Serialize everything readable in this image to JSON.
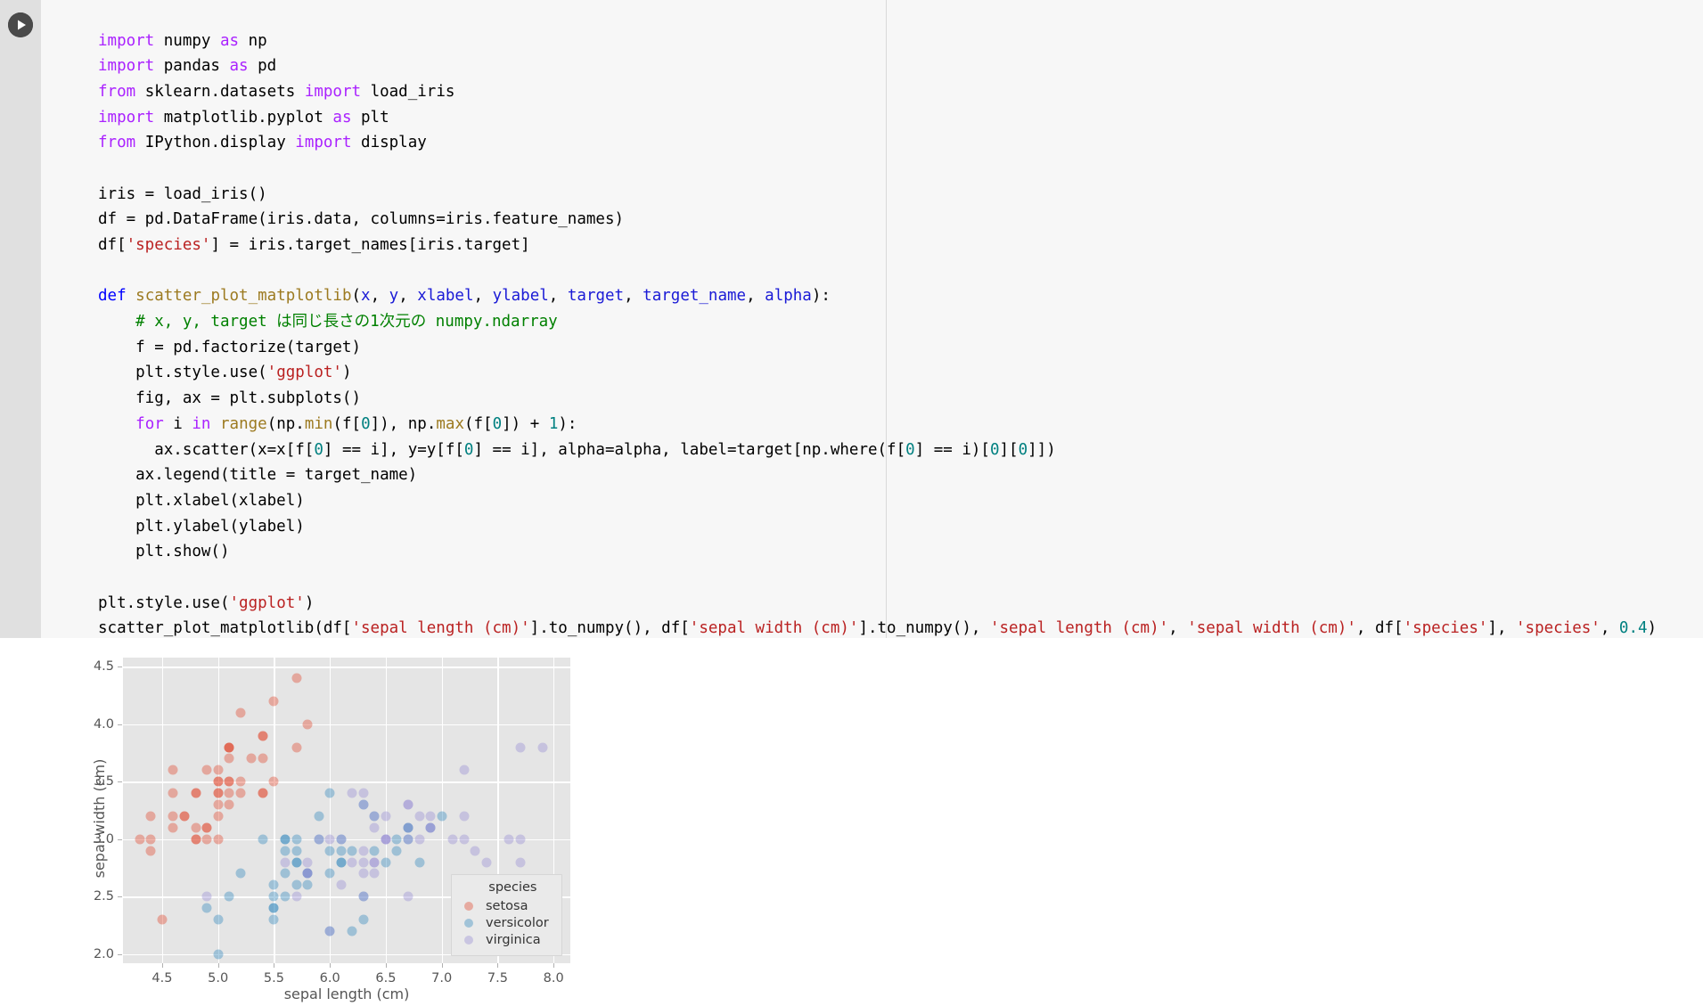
{
  "notebook": {
    "run_button_label": "run-cell",
    "code_lines": [
      [
        {
          "t": "import",
          "c": "kw"
        },
        {
          "t": " numpy ",
          "c": "plain"
        },
        {
          "t": "as",
          "c": "kw"
        },
        {
          "t": " np",
          "c": "plain"
        }
      ],
      [
        {
          "t": "import",
          "c": "kw"
        },
        {
          "t": " pandas ",
          "c": "plain"
        },
        {
          "t": "as",
          "c": "kw"
        },
        {
          "t": " pd",
          "c": "plain"
        }
      ],
      [
        {
          "t": "from",
          "c": "kw"
        },
        {
          "t": " sklearn.datasets ",
          "c": "plain"
        },
        {
          "t": "import",
          "c": "kw"
        },
        {
          "t": " load_iris",
          "c": "plain"
        }
      ],
      [
        {
          "t": "import",
          "c": "kw"
        },
        {
          "t": " matplotlib.pyplot ",
          "c": "plain"
        },
        {
          "t": "as",
          "c": "kw"
        },
        {
          "t": " plt",
          "c": "plain"
        }
      ],
      [
        {
          "t": "from",
          "c": "kw"
        },
        {
          "t": " IPython.display ",
          "c": "plain"
        },
        {
          "t": "import",
          "c": "kw"
        },
        {
          "t": " display",
          "c": "plain"
        }
      ],
      [],
      [
        {
          "t": "iris = load_iris()",
          "c": "plain"
        }
      ],
      [
        {
          "t": "df = pd.DataFrame(iris.data, columns=iris.feature_names)",
          "c": "plain"
        }
      ],
      [
        {
          "t": "df[",
          "c": "plain"
        },
        {
          "t": "'species'",
          "c": "str"
        },
        {
          "t": "] = iris.target_names[iris.target]",
          "c": "plain"
        }
      ],
      [],
      [
        {
          "t": "def",
          "c": "kw2"
        },
        {
          "t": " ",
          "c": "plain"
        },
        {
          "t": "scatter_plot_matplotlib",
          "c": "fn"
        },
        {
          "t": "(",
          "c": "plain"
        },
        {
          "t": "x",
          "c": "param"
        },
        {
          "t": ", ",
          "c": "plain"
        },
        {
          "t": "y",
          "c": "param"
        },
        {
          "t": ", ",
          "c": "plain"
        },
        {
          "t": "xlabel",
          "c": "param"
        },
        {
          "t": ", ",
          "c": "plain"
        },
        {
          "t": "ylabel",
          "c": "param"
        },
        {
          "t": ", ",
          "c": "plain"
        },
        {
          "t": "target",
          "c": "param"
        },
        {
          "t": ", ",
          "c": "plain"
        },
        {
          "t": "target_name",
          "c": "param"
        },
        {
          "t": ", ",
          "c": "plain"
        },
        {
          "t": "alpha",
          "c": "param"
        },
        {
          "t": "):",
          "c": "plain"
        }
      ],
      [
        {
          "t": "    # x, y, target は同じ長さの1次元の numpy.ndarray",
          "c": "cmt"
        }
      ],
      [
        {
          "t": "    f = pd.factorize(target)",
          "c": "plain"
        }
      ],
      [
        {
          "t": "    plt.style.use(",
          "c": "plain"
        },
        {
          "t": "'ggplot'",
          "c": "str"
        },
        {
          "t": ")",
          "c": "plain"
        }
      ],
      [
        {
          "t": "    fig, ax = plt.subplots()",
          "c": "plain"
        }
      ],
      [
        {
          "t": "    ",
          "c": "plain"
        },
        {
          "t": "for",
          "c": "kw"
        },
        {
          "t": " i ",
          "c": "plain"
        },
        {
          "t": "in",
          "c": "kw"
        },
        {
          "t": " ",
          "c": "plain"
        },
        {
          "t": "range",
          "c": "fn"
        },
        {
          "t": "(np.",
          "c": "plain"
        },
        {
          "t": "min",
          "c": "fn"
        },
        {
          "t": "(f[",
          "c": "plain"
        },
        {
          "t": "0",
          "c": "num"
        },
        {
          "t": "]), np.",
          "c": "plain"
        },
        {
          "t": "max",
          "c": "fn"
        },
        {
          "t": "(f[",
          "c": "plain"
        },
        {
          "t": "0",
          "c": "num"
        },
        {
          "t": "]) + ",
          "c": "plain"
        },
        {
          "t": "1",
          "c": "num"
        },
        {
          "t": "):",
          "c": "plain"
        }
      ],
      [
        {
          "t": "      ax.scatter(x=x[f[",
          "c": "plain"
        },
        {
          "t": "0",
          "c": "num"
        },
        {
          "t": "] == i], y=y[f[",
          "c": "plain"
        },
        {
          "t": "0",
          "c": "num"
        },
        {
          "t": "] == i], alpha=alpha, label=target[np.where(f[",
          "c": "plain"
        },
        {
          "t": "0",
          "c": "num"
        },
        {
          "t": "] == i)[",
          "c": "plain"
        },
        {
          "t": "0",
          "c": "num"
        },
        {
          "t": "][",
          "c": "plain"
        },
        {
          "t": "0",
          "c": "num"
        },
        {
          "t": "]])",
          "c": "plain"
        }
      ],
      [
        {
          "t": "    ax.legend(title = target_name)",
          "c": "plain"
        }
      ],
      [
        {
          "t": "    plt.xlabel(xlabel)",
          "c": "plain"
        }
      ],
      [
        {
          "t": "    plt.ylabel(ylabel)",
          "c": "plain"
        }
      ],
      [
        {
          "t": "    plt.show()",
          "c": "plain"
        }
      ],
      [],
      [
        {
          "t": "plt.style.use(",
          "c": "plain"
        },
        {
          "t": "'ggplot'",
          "c": "str"
        },
        {
          "t": ")",
          "c": "plain"
        }
      ],
      [
        {
          "t": "scatter_plot_matplotlib(df[",
          "c": "plain"
        },
        {
          "t": "'sepal length (cm)'",
          "c": "str"
        },
        {
          "t": "].to_numpy(), df[",
          "c": "plain"
        },
        {
          "t": "'sepal width (cm)'",
          "c": "str"
        },
        {
          "t": "].to_numpy(), ",
          "c": "plain"
        },
        {
          "t": "'sepal length (cm)'",
          "c": "str"
        },
        {
          "t": ", ",
          "c": "plain"
        },
        {
          "t": "'sepal width (cm)'",
          "c": "str"
        },
        {
          "t": ", df[",
          "c": "plain"
        },
        {
          "t": "'species'",
          "c": "str"
        },
        {
          "t": "], ",
          "c": "plain"
        },
        {
          "t": "'species'",
          "c": "str"
        },
        {
          "t": ", ",
          "c": "plain"
        },
        {
          "t": "0.4",
          "c": "num"
        },
        {
          "t": ")",
          "c": "plain"
        }
      ]
    ]
  },
  "chart_data": {
    "type": "scatter",
    "title": "",
    "xlabel": "sepal length (cm)",
    "ylabel": "sepal width (cm)",
    "xlim": [
      4.15,
      8.15
    ],
    "ylim": [
      1.92,
      4.58
    ],
    "xticks": [
      "4.5",
      "5.0",
      "5.5",
      "6.0",
      "6.5",
      "7.0",
      "7.5",
      "8.0"
    ],
    "xtick_values": [
      4.5,
      5.0,
      5.5,
      6.0,
      6.5,
      7.0,
      7.5,
      8.0
    ],
    "yticks": [
      "2.0",
      "2.5",
      "3.0",
      "3.5",
      "4.0",
      "4.5"
    ],
    "ytick_values": [
      2.0,
      2.5,
      3.0,
      3.5,
      4.0,
      4.5
    ],
    "grid": true,
    "style": "ggplot",
    "alpha": 0.4,
    "legend": {
      "title": "species",
      "position": "lower right",
      "entries": [
        {
          "name": "setosa",
          "color": "#E24A33"
        },
        {
          "name": "versicolor",
          "color": "#348ABD"
        },
        {
          "name": "virginica",
          "color": "#988ED5"
        }
      ]
    },
    "series": [
      {
        "name": "setosa",
        "color": "#E24A33",
        "x": [
          5.1,
          4.9,
          4.7,
          4.6,
          5.0,
          5.4,
          4.6,
          5.0,
          4.4,
          4.9,
          5.4,
          4.8,
          4.8,
          4.3,
          5.8,
          5.7,
          5.4,
          5.1,
          5.7,
          5.1,
          5.4,
          5.1,
          4.6,
          5.1,
          4.8,
          5.0,
          5.0,
          5.2,
          5.2,
          4.7,
          4.8,
          5.4,
          5.2,
          5.5,
          4.9,
          5.0,
          5.5,
          4.9,
          4.4,
          5.1,
          5.0,
          4.5,
          4.4,
          5.0,
          5.1,
          4.8,
          5.1,
          4.6,
          5.3,
          5.0
        ],
        "y": [
          3.5,
          3.0,
          3.2,
          3.1,
          3.6,
          3.9,
          3.4,
          3.4,
          2.9,
          3.1,
          3.7,
          3.4,
          3.0,
          3.0,
          4.0,
          4.4,
          3.9,
          3.5,
          3.8,
          3.8,
          3.4,
          3.7,
          3.6,
          3.3,
          3.4,
          3.0,
          3.4,
          3.5,
          3.4,
          3.2,
          3.1,
          3.4,
          4.1,
          4.2,
          3.1,
          3.2,
          3.5,
          3.6,
          3.0,
          3.4,
          3.5,
          2.3,
          3.2,
          3.5,
          3.8,
          3.0,
          3.8,
          3.2,
          3.7,
          3.3
        ]
      },
      {
        "name": "versicolor",
        "color": "#348ABD",
        "x": [
          7.0,
          6.4,
          6.9,
          5.5,
          6.5,
          5.7,
          6.3,
          4.9,
          6.6,
          5.2,
          5.0,
          5.9,
          6.0,
          6.1,
          5.6,
          6.7,
          5.6,
          5.8,
          6.2,
          5.6,
          5.9,
          6.1,
          6.3,
          6.1,
          6.4,
          6.6,
          6.8,
          6.7,
          6.0,
          5.7,
          5.5,
          5.5,
          5.8,
          6.0,
          5.4,
          6.0,
          6.7,
          6.3,
          5.6,
          5.5,
          5.5,
          6.1,
          5.8,
          5.0,
          5.6,
          5.7,
          5.7,
          6.2,
          5.1,
          5.7
        ],
        "y": [
          3.2,
          3.2,
          3.1,
          2.3,
          2.8,
          2.8,
          3.3,
          2.4,
          2.9,
          2.7,
          2.0,
          3.0,
          2.2,
          2.9,
          2.9,
          3.1,
          3.0,
          2.7,
          2.2,
          2.5,
          3.2,
          2.8,
          2.5,
          2.8,
          2.9,
          3.0,
          2.8,
          3.0,
          2.9,
          2.6,
          2.4,
          2.4,
          2.7,
          2.7,
          3.0,
          3.4,
          3.1,
          2.3,
          3.0,
          2.5,
          2.6,
          3.0,
          2.6,
          2.3,
          2.7,
          3.0,
          2.9,
          2.9,
          2.5,
          2.8
        ]
      },
      {
        "name": "virginica",
        "color": "#988ED5",
        "x": [
          6.3,
          5.8,
          7.1,
          6.3,
          6.5,
          7.6,
          4.9,
          7.3,
          6.7,
          7.2,
          6.5,
          6.4,
          6.8,
          5.7,
          5.8,
          6.4,
          6.5,
          7.7,
          7.7,
          6.0,
          6.9,
          5.6,
          7.7,
          6.3,
          6.7,
          7.2,
          6.2,
          6.1,
          6.4,
          7.2,
          7.4,
          7.9,
          6.4,
          6.3,
          6.1,
          7.7,
          6.3,
          6.4,
          6.0,
          6.9,
          6.7,
          6.9,
          5.8,
          6.8,
          6.7,
          6.7,
          6.3,
          6.5,
          6.2,
          5.9
        ],
        "y": [
          3.3,
          2.7,
          3.0,
          2.9,
          3.0,
          3.0,
          2.5,
          2.9,
          2.5,
          3.6,
          3.2,
          2.7,
          3.0,
          2.5,
          2.8,
          3.2,
          3.0,
          3.8,
          2.6,
          2.2,
          3.2,
          2.8,
          2.8,
          2.7,
          3.3,
          3.2,
          2.8,
          3.0,
          2.8,
          3.0,
          2.8,
          3.8,
          2.8,
          2.8,
          2.6,
          3.0,
          3.4,
          3.1,
          3.0,
          3.1,
          3.1,
          3.1,
          2.7,
          3.2,
          3.3,
          3.0,
          2.5,
          3.0,
          3.4,
          3.0
        ]
      }
    ]
  }
}
